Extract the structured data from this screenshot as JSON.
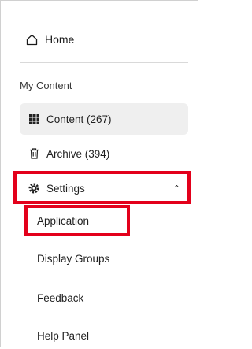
{
  "nav": {
    "home_label": "Home",
    "section_label": "My Content",
    "content_label": "Content (267)",
    "archive_label": "Archive (394)",
    "settings_label": "Settings",
    "sub_items": [
      "Application",
      "Display Groups",
      "Feedback",
      "Help Panel"
    ]
  },
  "icons": {
    "home": "home-icon",
    "content": "grid-icon",
    "archive": "trash-icon",
    "settings": "gear-icon",
    "expand": "chevron-up-icon"
  },
  "colors": {
    "highlight": "#e3001b",
    "active_bg": "#efefef"
  }
}
